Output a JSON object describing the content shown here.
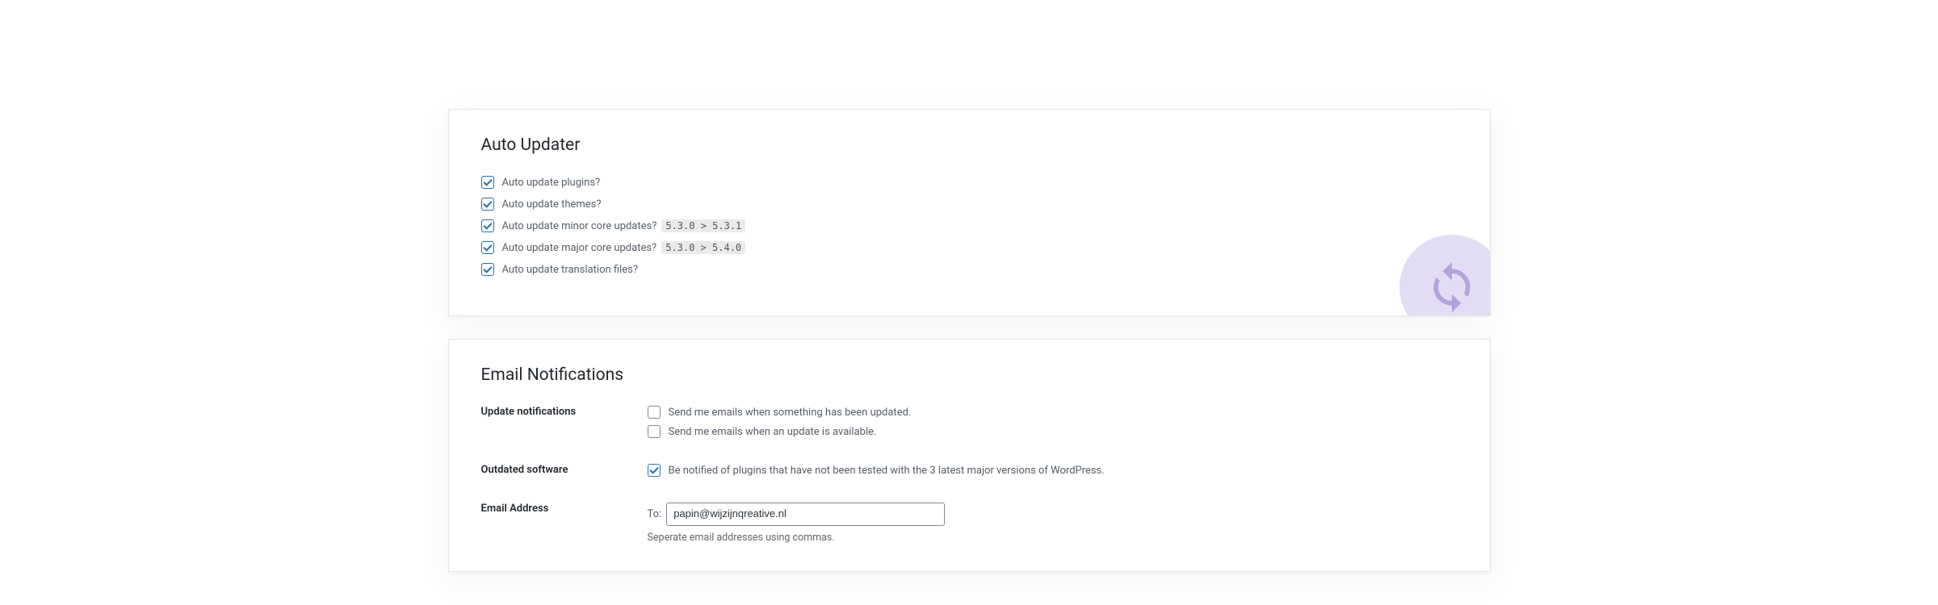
{
  "auto_updater": {
    "title": "Auto Updater",
    "items": [
      {
        "label": "Auto update plugins?",
        "checked": true
      },
      {
        "label": "Auto update themes?",
        "checked": true
      },
      {
        "label": "Auto update minor core updates?",
        "hint": "5.3.0 > 5.3.1",
        "checked": true
      },
      {
        "label": "Auto update major core updates?",
        "hint": "5.3.0 > 5.4.0",
        "checked": true
      },
      {
        "label": "Auto update translation files?",
        "checked": true
      }
    ]
  },
  "email_notifications": {
    "title": "Email Notifications",
    "update_notifications": {
      "label": "Update notifications",
      "opts": [
        {
          "label": "Send me emails when something has been updated.",
          "checked": false
        },
        {
          "label": "Send me emails when an update is available.",
          "checked": false
        }
      ]
    },
    "outdated_software": {
      "label": "Outdated software",
      "opt": {
        "label": "Be notified of plugins that have not been tested with the 3 latest major versions of WordPress.",
        "checked": true
      }
    },
    "email_address": {
      "label": "Email Address",
      "to_label": "To:",
      "value": "papin@wijzijnqreative.nl",
      "helper": "Seperate email addresses using commas."
    }
  }
}
